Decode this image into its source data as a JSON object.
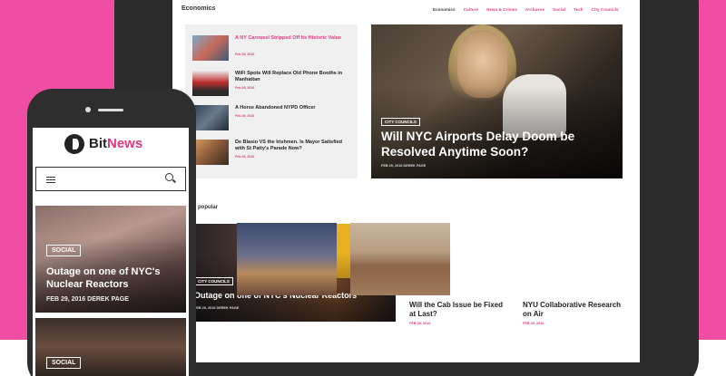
{
  "site": {
    "section_title": "Economics",
    "nav": [
      "Economics",
      "Culture",
      "News & Crimes",
      "Archaeos",
      "Social",
      "Tech",
      "City Councils"
    ],
    "list_items": [
      {
        "title": "A NY Carousel Stripped Off Its Historic Value",
        "date": "Feb 29, 2016",
        "pink": true
      },
      {
        "title": "WiFi Spots Will Replace Old Phone Booths in Manhattan",
        "date": "Feb 29, 2016",
        "pink": false
      },
      {
        "title": "A Horse Abandoned NYPD Officer",
        "date": "Feb 29, 2016",
        "pink": false
      },
      {
        "title": "De Blasio VS the Irishmen. Is Mayor Satisfied with St Patty's Parade Now?",
        "date": "Feb 29, 2016",
        "pink": false
      }
    ],
    "hero": {
      "tag": "City Councils",
      "title": "Will NYC Airports Delay Doom be Resolved Anytime Soon?",
      "meta": "FEB 29, 2016      DEREK PAGE"
    },
    "popular_label": "popular",
    "feature2": {
      "tag": "City Councils",
      "title": "Outage on one of NYC's Nuclear Reactors",
      "meta": "FEB 29, 2016      DEREK PAGE"
    },
    "cards": [
      {
        "title": "Will the Cab Issue be Fixed at Last?",
        "date": "FEB 29, 2016"
      },
      {
        "title": "NYU Collaborative Research on Air",
        "date": "FEB 29, 2016"
      }
    ]
  },
  "phone": {
    "logo_bit": "Bit",
    "logo_news": "News",
    "card1": {
      "tag": "SOCIAL",
      "title": "Outage on one of NYC's Nuclear Reactors",
      "meta": "FEB 29, 2016      DEREK PAGE"
    },
    "card2": {
      "tag": "SOCIAL"
    }
  },
  "colors": {
    "brand_pink": "#ee4fa5",
    "accent": "#e2377f",
    "device": "#2b2b2b"
  }
}
